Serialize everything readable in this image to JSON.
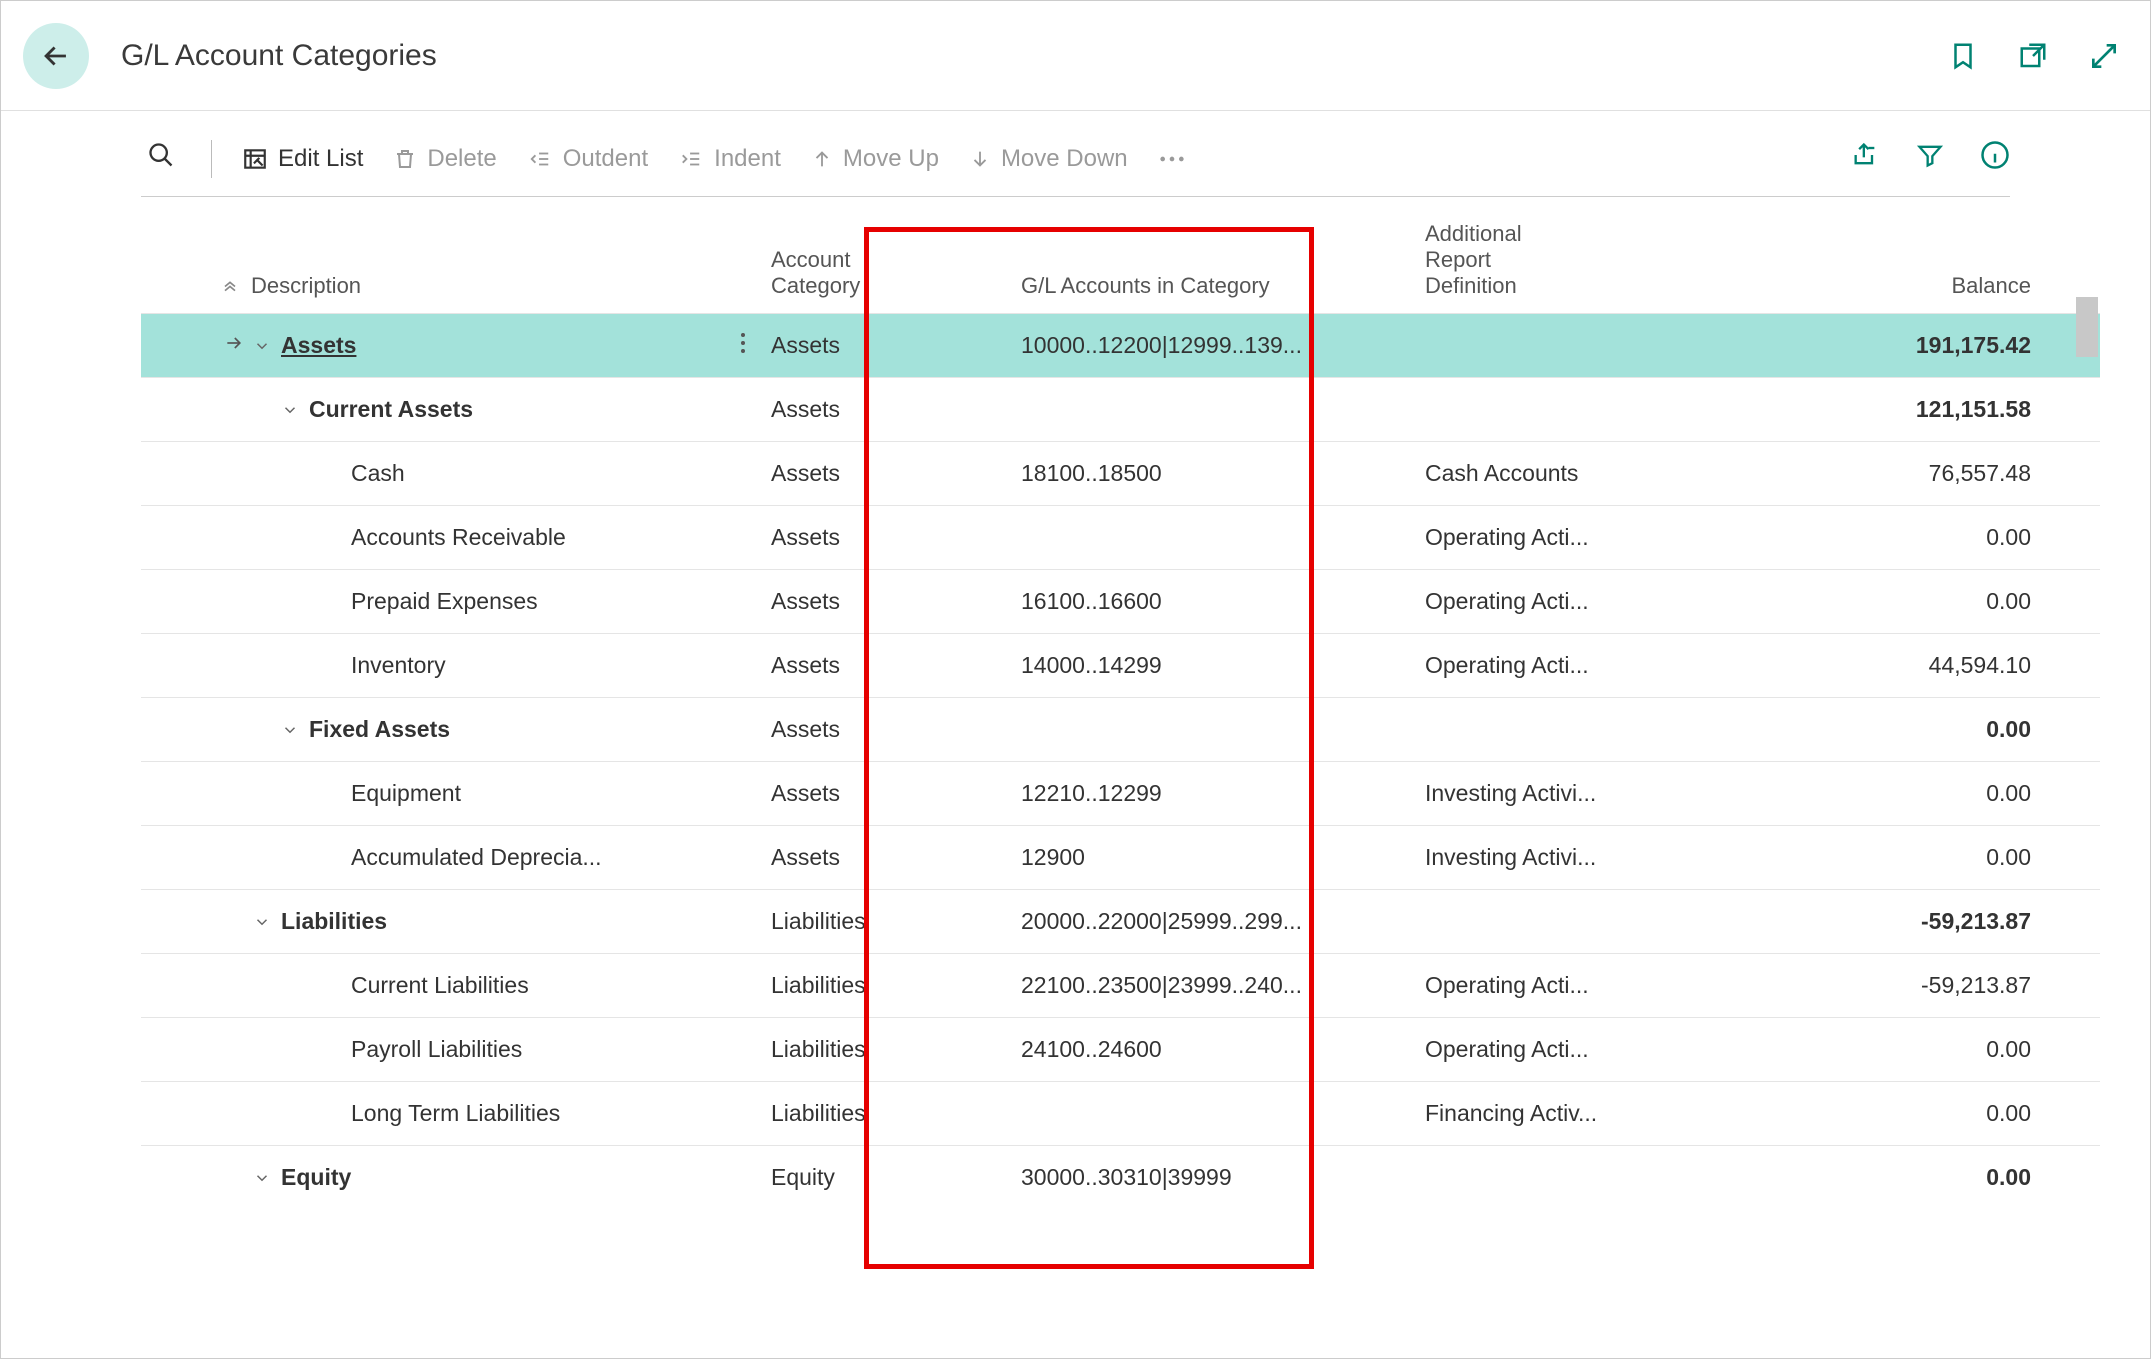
{
  "page_title": "G/L Account Categories",
  "toolbar": {
    "edit_list": "Edit List",
    "delete": "Delete",
    "outdent": "Outdent",
    "indent": "Indent",
    "move_up": "Move Up",
    "move_down": "Move Down"
  },
  "columns": {
    "description": "Description",
    "account_category": "Account Category",
    "gl_accounts": "G/L Accounts in Category",
    "additional_def": "Additional Report Definition",
    "balance": "Balance"
  },
  "rows": [
    {
      "indent": 0,
      "bold": true,
      "selected": true,
      "expand": true,
      "desc": "Assets",
      "underline": true,
      "cat": "Assets",
      "gl": "10000..12200|12999..139...",
      "def": "",
      "bal": "191,175.42"
    },
    {
      "indent": 1,
      "bold": true,
      "expand": true,
      "desc": "Current Assets",
      "cat": "Assets",
      "gl": "",
      "def": "",
      "bal": "121,151.58"
    },
    {
      "indent": 2,
      "desc": "Cash",
      "cat": "Assets",
      "gl": "18100..18500",
      "def": "Cash Accounts",
      "bal": "76,557.48"
    },
    {
      "indent": 2,
      "desc": "Accounts Receivable",
      "cat": "Assets",
      "gl": "",
      "def": "Operating Acti...",
      "bal": "0.00"
    },
    {
      "indent": 2,
      "desc": "Prepaid Expenses",
      "cat": "Assets",
      "gl": "16100..16600",
      "def": "Operating Acti...",
      "bal": "0.00"
    },
    {
      "indent": 2,
      "desc": "Inventory",
      "cat": "Assets",
      "gl": "14000..14299",
      "def": "Operating Acti...",
      "bal": "44,594.10"
    },
    {
      "indent": 1,
      "bold": true,
      "expand": true,
      "desc": "Fixed Assets",
      "cat": "Assets",
      "gl": "",
      "def": "",
      "bal": "0.00"
    },
    {
      "indent": 2,
      "desc": "Equipment",
      "cat": "Assets",
      "gl": "12210..12299",
      "def": "Investing Activi...",
      "bal": "0.00"
    },
    {
      "indent": 2,
      "desc": "Accumulated Deprecia...",
      "cat": "Assets",
      "gl": "12900",
      "def": "Investing Activi...",
      "bal": "0.00"
    },
    {
      "indent": 0,
      "bold": true,
      "expand": true,
      "desc": "Liabilities",
      "cat": "Liabilities",
      "gl": "20000..22000|25999..299...",
      "def": "",
      "bal": "-59,213.87"
    },
    {
      "indent": 2,
      "desc": "Current Liabilities",
      "cat": "Liabilities",
      "gl": "22100..23500|23999..240...",
      "def": "Operating Acti...",
      "bal": "-59,213.87"
    },
    {
      "indent": 2,
      "desc": "Payroll Liabilities",
      "cat": "Liabilities",
      "gl": "24100..24600",
      "def": "Operating Acti...",
      "bal": "0.00"
    },
    {
      "indent": 2,
      "desc": "Long Term Liabilities",
      "cat": "Liabilities",
      "gl": "",
      "def": "Financing Activ...",
      "bal": "0.00"
    },
    {
      "indent": 0,
      "bold": true,
      "expand": true,
      "desc": "Equity",
      "cat": "Equity",
      "gl": "30000..30310|39999",
      "def": "",
      "bal": "0.00"
    }
  ]
}
